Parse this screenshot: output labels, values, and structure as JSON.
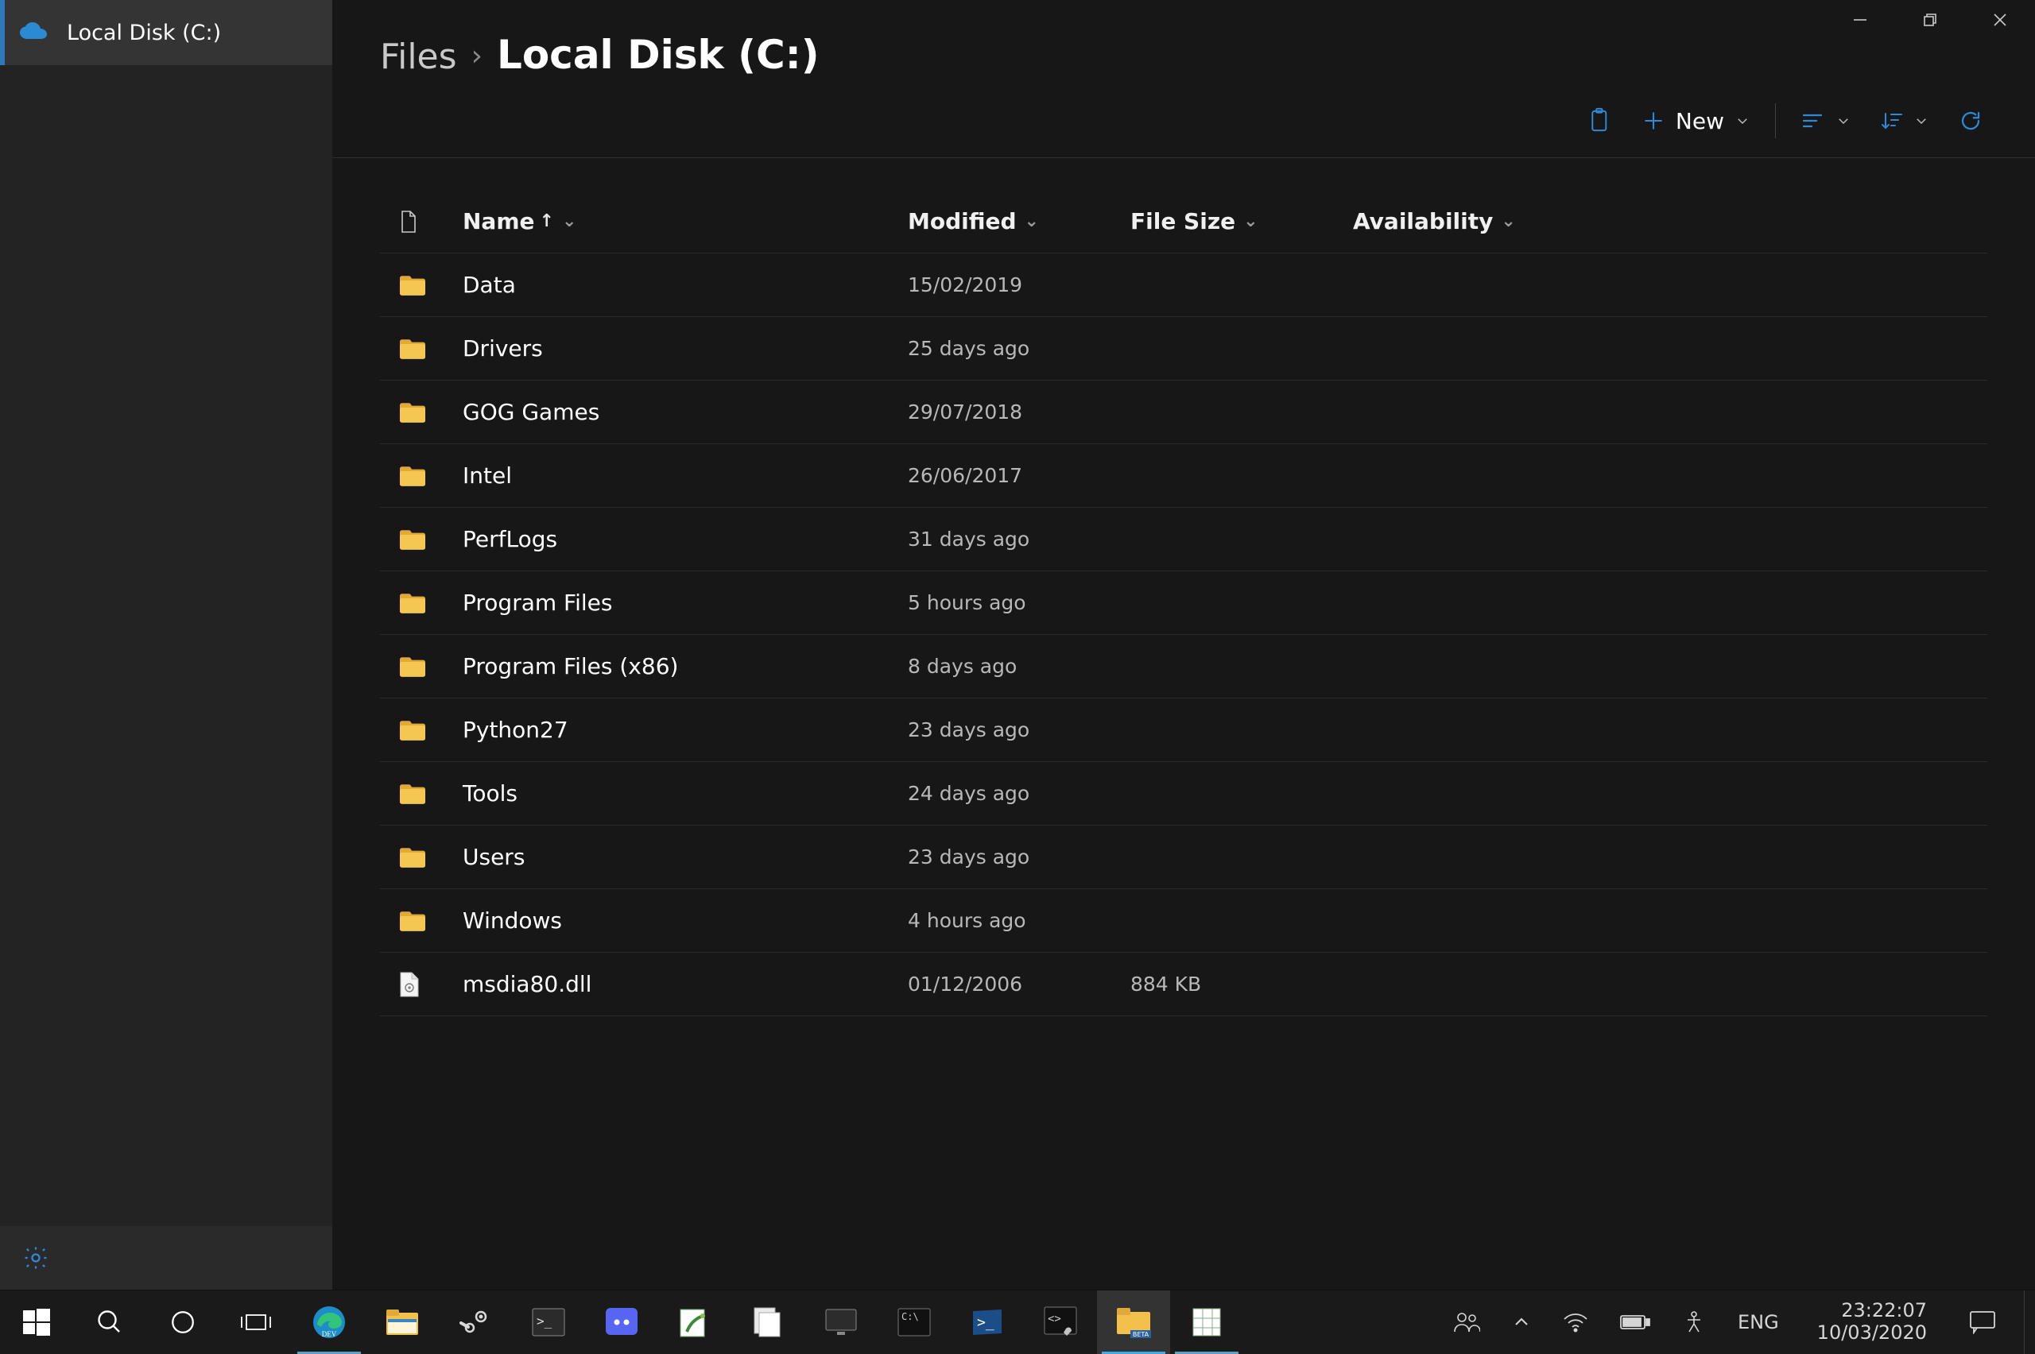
{
  "sidebar": {
    "items": [
      {
        "label": "Local Disk (C:)"
      }
    ]
  },
  "breadcrumb": {
    "root": "Files",
    "current": "Local Disk (C:)"
  },
  "toolbar": {
    "new_label": "New"
  },
  "columns": {
    "name": "Name",
    "modified": "Modified",
    "file_size": "File Size",
    "availability": "Availability"
  },
  "rows": [
    {
      "type": "folder",
      "name": "Data",
      "modified": "15/02/2019",
      "size": "",
      "availability": ""
    },
    {
      "type": "folder",
      "name": "Drivers",
      "modified": "25 days ago",
      "size": "",
      "availability": ""
    },
    {
      "type": "folder",
      "name": "GOG Games",
      "modified": "29/07/2018",
      "size": "",
      "availability": ""
    },
    {
      "type": "folder",
      "name": "Intel",
      "modified": "26/06/2017",
      "size": "",
      "availability": ""
    },
    {
      "type": "folder",
      "name": "PerfLogs",
      "modified": "31 days ago",
      "size": "",
      "availability": ""
    },
    {
      "type": "folder",
      "name": "Program Files",
      "modified": "5 hours ago",
      "size": "",
      "availability": ""
    },
    {
      "type": "folder",
      "name": "Program Files (x86)",
      "modified": "8 days ago",
      "size": "",
      "availability": ""
    },
    {
      "type": "folder",
      "name": "Python27",
      "modified": "23 days ago",
      "size": "",
      "availability": ""
    },
    {
      "type": "folder",
      "name": "Tools",
      "modified": "24 days ago",
      "size": "",
      "availability": ""
    },
    {
      "type": "folder",
      "name": "Users",
      "modified": "23 days ago",
      "size": "",
      "availability": ""
    },
    {
      "type": "folder",
      "name": "Windows",
      "modified": "4 hours ago",
      "size": "",
      "availability": ""
    },
    {
      "type": "file",
      "name": "msdia80.dll",
      "modified": "01/12/2006",
      "size": "884 KB",
      "availability": ""
    }
  ],
  "tray": {
    "language": "ENG",
    "time": "23:22:07",
    "date": "10/03/2020"
  }
}
